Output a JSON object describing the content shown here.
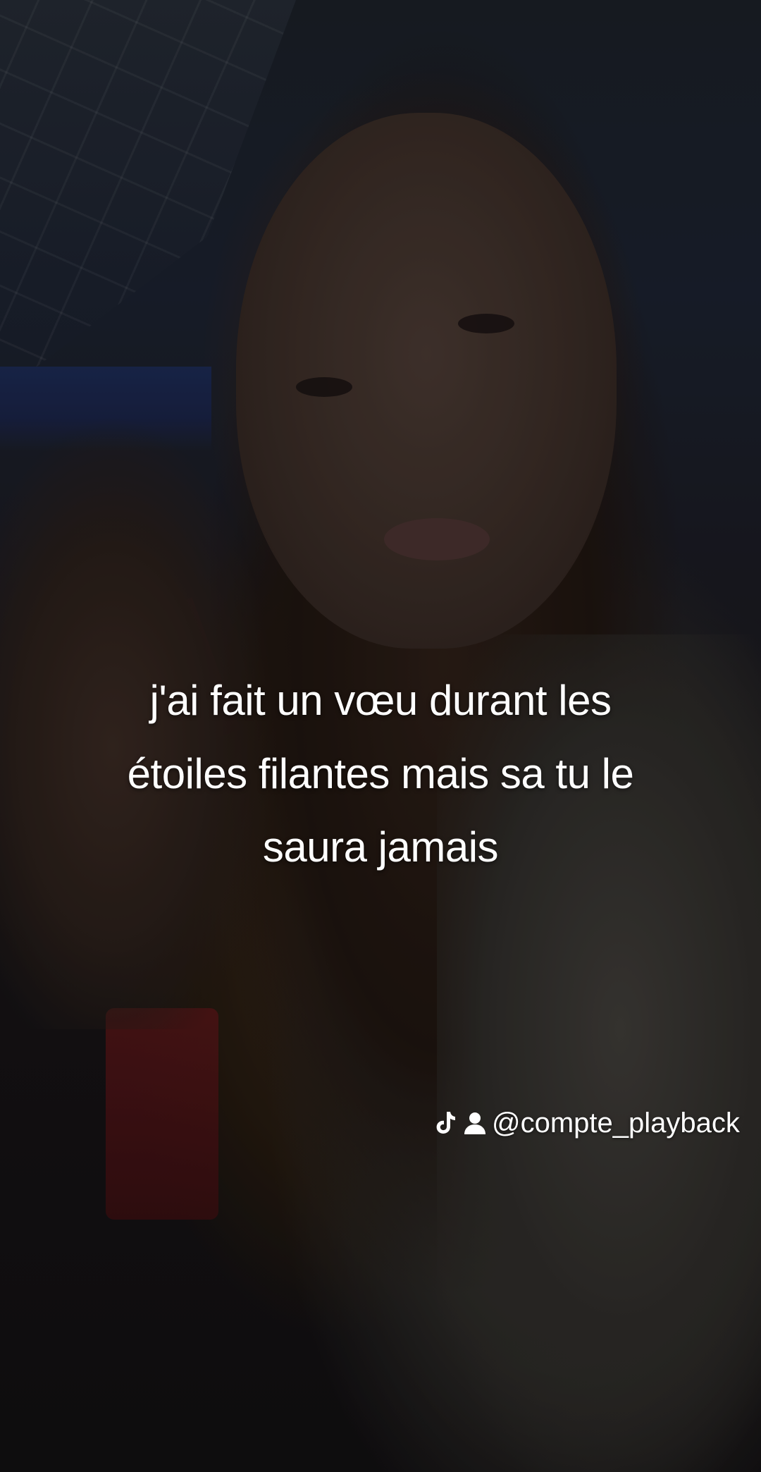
{
  "caption": {
    "line1": "j'ai fait un vœu durant les",
    "line2": "étoiles filantes mais sa tu le",
    "line3": "saura jamais"
  },
  "watermark": {
    "icons": [
      "tiktok-logo-icon",
      "user-icon"
    ],
    "handle": "@compte_playback"
  }
}
